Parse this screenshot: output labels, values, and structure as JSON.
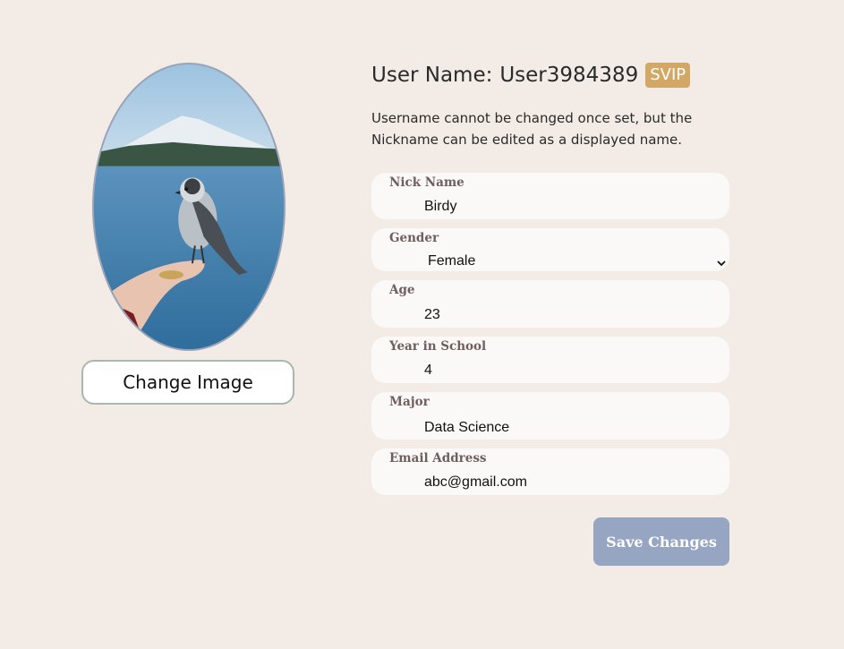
{
  "profile": {
    "change_image_label": "Change Image"
  },
  "header": {
    "user_name_label": "User Name:",
    "user_name_value": "User3984389",
    "badge": "SVIP",
    "description": "Username cannot be changed once set, but the Nickname can be edited as a displayed name."
  },
  "fields": [
    {
      "label": "Nick Name",
      "value": "Birdy"
    },
    {
      "label": "Gender",
      "value": "Female"
    },
    {
      "label": "Age",
      "value": "23"
    },
    {
      "label": "Year in School",
      "value": "4"
    },
    {
      "label": "Major",
      "value": "Data Science"
    },
    {
      "label": "Email Address",
      "value": "abc@gmail.com"
    }
  ],
  "save_label": "Save Changes",
  "colors": {
    "background": "#f3ece6",
    "badge": "#d3a766",
    "save_button": "#95a5c2",
    "field_label": "#6e5e5e"
  },
  "icons": {
    "select_arrow": "chevron-down-icon"
  }
}
